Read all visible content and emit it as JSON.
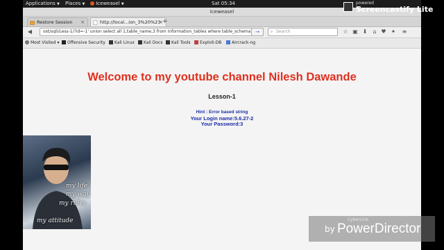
{
  "topbar": {
    "applications": "Applications",
    "places": "Places",
    "app": "Iceweasel",
    "clock": "Sat 05:34"
  },
  "window": {
    "title": "Iceweasel"
  },
  "tabs": [
    {
      "label": "Restore Session",
      "active": false
    },
    {
      "label": "http://local...ion_3%20%23",
      "active": true
    }
  ],
  "navbar": {
    "url": "ost/sqli/Less-1/?id=-1'  union select  all 1,table_name,3 from information_tables where table_schema",
    "search_placeholder": "Search"
  },
  "bookmarks": [
    {
      "label": "Most Visited",
      "dropdown": true,
      "icon": "gear-icon"
    },
    {
      "label": "Offensive Security",
      "icon": "offsec-icon"
    },
    {
      "label": "Kali Linux",
      "icon": "kali-icon"
    },
    {
      "label": "Kali Docs",
      "icon": "kali-icon"
    },
    {
      "label": "Kali Tools",
      "icon": "kali-icon"
    },
    {
      "label": "Exploit-DB",
      "icon": "exploitdb-icon"
    },
    {
      "label": "Aircrack-ng",
      "icon": "aircrack-icon"
    }
  ],
  "page": {
    "heading": "Welcome to my youtube channel Nilesh Dawande",
    "lesson": "Lesson-1",
    "hint": "Hint : Error based string",
    "login": "Your Login name:5.6.27-2",
    "password": "Your Password:3"
  },
  "photo": {
    "lines": [
      "my life",
      "my way",
      "my rules",
      "my attitude"
    ]
  },
  "watermarks": {
    "castify_small": "powered by",
    "castify_big": "Screencastify Lite",
    "cyberlink": "CyberLink",
    "by": "by",
    "powerdirector": "PowerDirector"
  },
  "colors": {
    "heading": "#e0301e",
    "info": "#1d2ea8"
  }
}
